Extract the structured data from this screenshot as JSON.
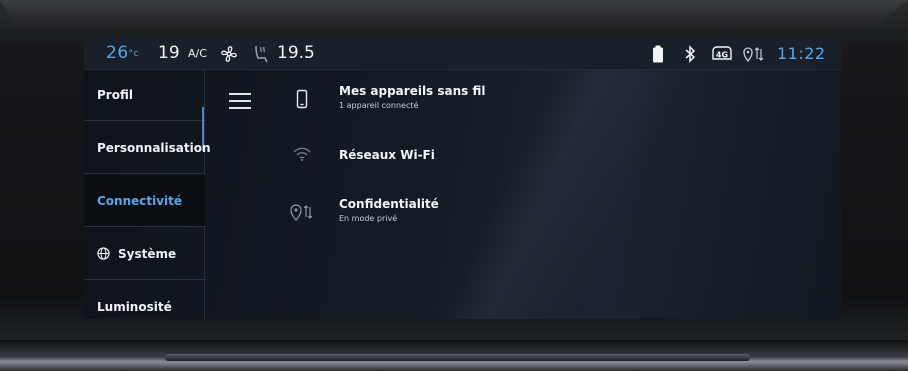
{
  "status_bar": {
    "driver_temp": "26",
    "driver_temp_unit": "°c",
    "fan_level": "19",
    "ac_label": "A/C",
    "passenger_temp": "19.5",
    "time": "11:22",
    "icons": [
      "fan-icon",
      "seat-heat-icon",
      "battery-icon",
      "bluetooth-icon",
      "4g-icon",
      "location-share-icon"
    ],
    "network_label": "4G"
  },
  "menu": {
    "items": [
      {
        "label": "Profil"
      },
      {
        "label": "Personnalisation"
      },
      {
        "label": "Connectivité"
      },
      {
        "label": "Système"
      },
      {
        "label": "Luminosité"
      }
    ],
    "active_index": 2
  },
  "content": {
    "rows": [
      {
        "title": "Mes appareils sans fil",
        "subtitle": "1 appareil connecté",
        "icon": "phone-icon"
      },
      {
        "title": "Réseaux Wi-Fi",
        "subtitle": "",
        "icon": "wifi-icon"
      },
      {
        "title": "Confidentialité",
        "subtitle": "En mode privé",
        "icon": "privacy-location-icon"
      }
    ]
  },
  "colors": {
    "accent": "#5aa6ec",
    "text": "#f0f3f7",
    "status_bg": "#1a2029"
  }
}
